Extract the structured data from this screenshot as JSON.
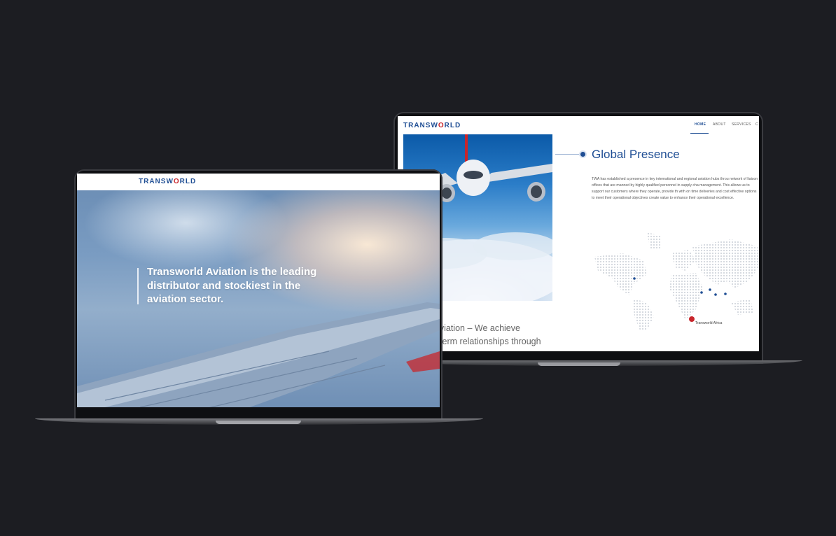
{
  "back_site": {
    "logo": {
      "text_before": "TRANSW",
      "o": "O",
      "text_after": "RLD"
    },
    "nav": [
      {
        "label": "HOME",
        "active": true
      },
      {
        "label": "ABOUT",
        "active": false
      },
      {
        "label": "SERVICES",
        "active": false
      },
      {
        "label": "C",
        "active": false
      }
    ],
    "section_title": "Global Presence",
    "paragraph": "TWA has established a presence in key international and regional aviation hubs throu network of liaison offices that are manned by highly qualified personnel in supply cha management. This allows us to support our customers where they operate, provide th with on time deliveries and cost effective options to meet their operational objectives create value to enhance their operational excellence.",
    "map_label": "Transworld Africa",
    "bottom_text_line1": "d Aviation – We achieve",
    "bottom_text_line2": "ng-term relationships through"
  },
  "front_site": {
    "logo": {
      "text_before": "TRANSW",
      "o": "O",
      "text_after": "RLD"
    },
    "headline": "Transworld Aviation is the leading distributor and stockiest in the aviation sector."
  },
  "colors": {
    "background": "#1c1d22",
    "brand_blue": "#1f4e94",
    "brand_red": "#c8252b"
  }
}
